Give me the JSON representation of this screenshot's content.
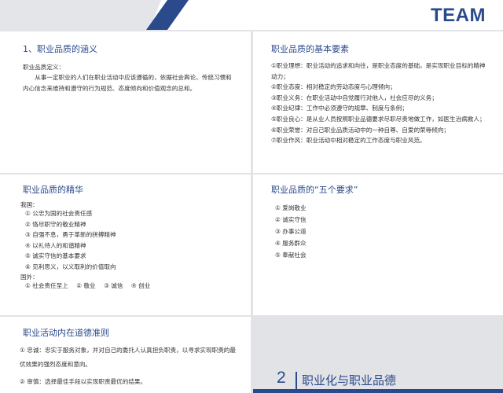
{
  "header": {
    "title": "TEAM"
  },
  "card1": {
    "title": "1、职业品质的涵义",
    "label": "职业品质定义：",
    "paragraph": "从事一定职业的人们在职业活动中应该遵循的，依据社会舆论、传统习惯和内心信念来维持和遵守的行为规范、态度倾向和价值观念的总和。"
  },
  "card2": {
    "title": "职业品质的基本要素",
    "items": [
      "①职业理想：职业活动的追求和向往，是职业态度的基础，是实现职业目标的精神动力；",
      "②职业态度：相对稳定的劳动态度与心理倾向；",
      "③职业义务：在职业活动中自觉履行对他人，社会应尽的义务；",
      "④职业纪律：工作中必须遵守的规章、制度与条例；",
      "⑤职业良心：是从业人员按照职业品德要求尽职尽责地做工作，如医生治病救人；",
      "⑥职业荣誉：对自己职业品质活动中的一种自尊、自爱的荣辱倾向；",
      "⑦职业作风：职业活动中相对稳定的工作态度与职业风范。"
    ]
  },
  "card3": {
    "title": "职业品质的精华",
    "domestic_label": "我国：",
    "domestic_items": [
      "① 公忠为国的社会责任感",
      "② 恪尽职守的敬业精神",
      "③ 自强不息，勇于革新的拼搏精神",
      "④ 以礼待人的和谐精神",
      "⑤ 诚实守信的基本要求",
      "⑥ 见利思义，以义取利的价值取向"
    ],
    "foreign_label": "国外：",
    "foreign_items": [
      "① 社会责任至上",
      "② 敬业",
      "③ 诚信",
      "④ 创业"
    ]
  },
  "card4": {
    "title": "职业品质的“五个要求”",
    "items": [
      "① 爱岗敬业",
      "② 诚实守信",
      "③ 办事公道",
      "④ 服务群众",
      "⑤ 奉献社会"
    ]
  },
  "card5": {
    "title": "职业活动内在道德准则",
    "items": [
      "① 忠诚：忠实于服务对象，并对自己的委托人认真担负职责，以寻求实现职责的最优效果的强烈态度和意向。",
      "② 审慎：选择最佳手段以实现职责最优的结果。"
    ]
  },
  "section": {
    "number": "2",
    "title": "职业化与职业品德"
  },
  "colors": {
    "accent": "#2a4a8c",
    "background": "#e2e3e6",
    "card": "#ffffff",
    "text": "#333333"
  }
}
